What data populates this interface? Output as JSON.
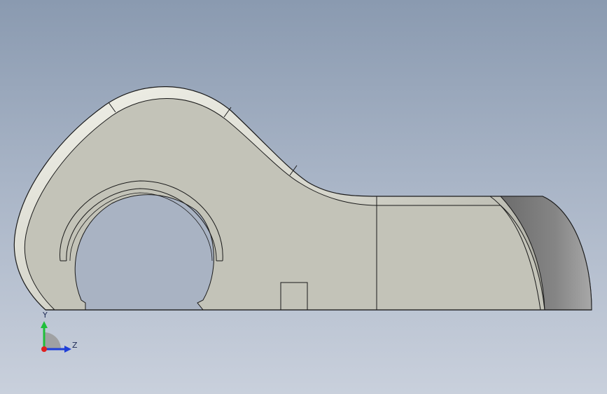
{
  "viewport": {
    "background_top": "#8a9ab0",
    "background_bottom": "#c9d0dc"
  },
  "model": {
    "face_color": "#c3c3b8",
    "edge_color": "#1a1a1a",
    "fillet_color": "#dcdcd2",
    "shadow_face_color": "#7a7a7a"
  },
  "triad": {
    "y_axis_label": "Y",
    "z_axis_label": "Z",
    "y_color": "#1fbf3a",
    "z_color": "#1f3fd8",
    "x_color": "#e01f1f"
  }
}
